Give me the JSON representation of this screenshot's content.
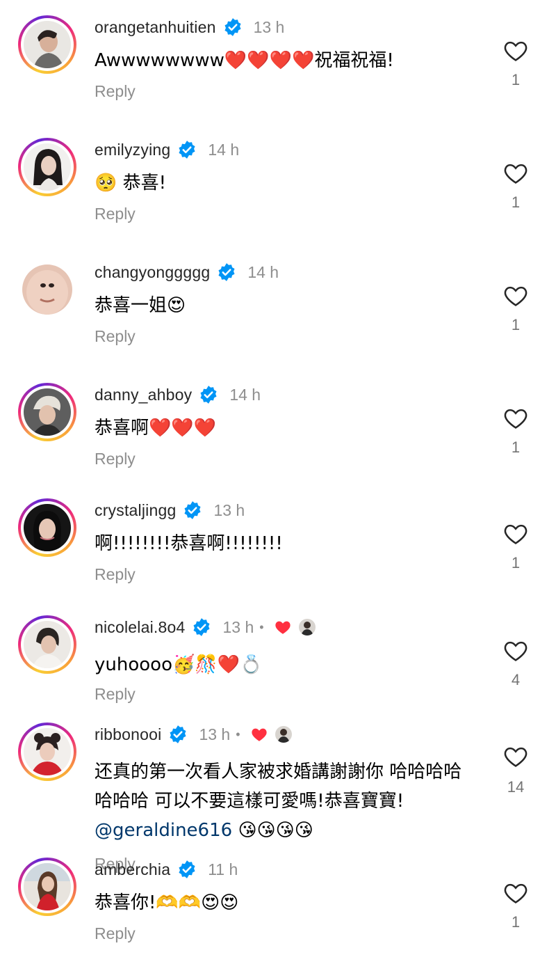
{
  "comments": [
    {
      "username": "orangetanhuitien",
      "time": "13 h",
      "text": "Awwwwwwww❤️❤️❤️❤️祝福祝福!",
      "reply_label": "Reply",
      "likes": "1",
      "avatar_icon": "portrait-short-hair-side-profile",
      "story_ring": true
    },
    {
      "username": "emilyzying",
      "time": "14 h",
      "text": "🥺 恭喜!",
      "reply_label": "Reply",
      "likes": "1",
      "avatar_icon": "portrait-dark-hair-woman",
      "story_ring": true
    },
    {
      "username": "changyonggggg",
      "time": "14 h",
      "text": "恭喜一姐😍",
      "reply_label": "Reply",
      "likes": "1",
      "avatar_icon": "face-closeup",
      "story_ring": false
    },
    {
      "username": "danny_ahboy",
      "time": "14 h",
      "text": "恭喜啊❤️❤️❤️",
      "reply_label": "Reply",
      "likes": "1",
      "avatar_icon": "portrait-blond-man",
      "story_ring": true
    },
    {
      "username": "crystaljingg",
      "time": "13 h",
      "text": "啊!!!!!!!!恭喜啊!!!!!!!!",
      "reply_label": "Reply",
      "likes": "1",
      "avatar_icon": "portrait-dark-background-woman",
      "story_ring": true
    },
    {
      "username": "nicolelai.8o4",
      "time": "13 h",
      "liked_by_creator": true,
      "text": "yuhoooo🥳🎊❤️💍",
      "reply_label": "Reply",
      "likes": "4",
      "avatar_icon": "portrait-woman-white-outfit",
      "story_ring": true
    },
    {
      "username": "ribbonooi",
      "time": "13 h",
      "liked_by_creator": true,
      "text": "还真的第一次看人家被求婚講謝謝你 哈哈哈哈哈哈哈 可以不要這樣可愛嗎!恭喜寶寶!",
      "mention": "@geraldine616",
      "mention_emojis": "😘😘😘😘",
      "reply_label": "Reply",
      "likes": "14",
      "avatar_icon": "portrait-woman-red-outfit",
      "story_ring": true
    },
    {
      "username": "amberchia",
      "time": "11 h",
      "text": "恭喜你!🫶🫶😍😍",
      "reply_label": "Reply",
      "likes": "1",
      "avatar_icon": "portrait-woman-red-dress",
      "story_ring": true
    }
  ],
  "colors": {
    "verified_blue": "#0095f6",
    "like_red": "#ff3040",
    "secondary_text": "#8e8e8e",
    "mention_blue": "#00376b"
  }
}
